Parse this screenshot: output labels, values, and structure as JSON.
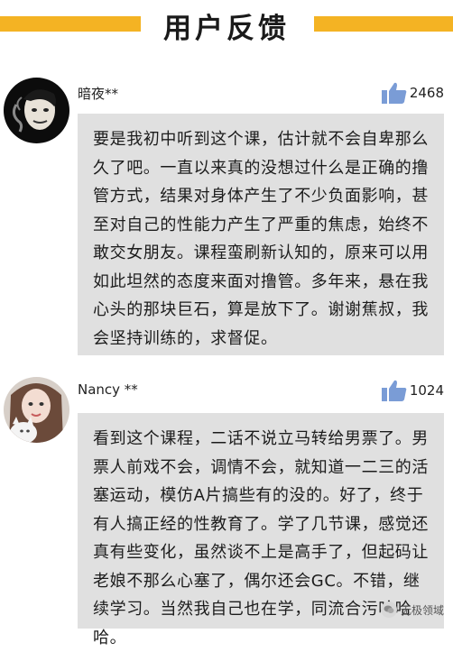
{
  "header": {
    "title": "用户反馈",
    "accent_color": "#f4b323"
  },
  "comments": [
    {
      "username": "暗夜**",
      "avatar": "avatar-smoking-man-icon",
      "likes": "2468",
      "text": "要是我初中听到这个课，估计就不会自卑那么久了吧。一直以来真的没想过什么是正确的撸管方式，结果对身体产生了不少负面影响，甚至对自己的性能力产生了严重的焦虑，始终不敢交女朋友。课程蛮刷新认知的，原来可以用如此坦然的态度来面对撸管。多年来，悬在我心头的那块巨石，算是放下了。谢谢蕉叔，我会坚持训练的，求督促。"
    },
    {
      "username": "Nancy **",
      "avatar": "avatar-girl-with-cat-icon",
      "likes": "1024",
      "text": "看到这个课程，二话不说立马转给男票了。男票人前戏不会，调情不会，就知道一二三的活塞运动，模仿A片搞些有的没的。好了，终于有人搞正经的性教育了。学了几节课，感觉还真有些变化，虽然谈不上是高手了，但起码让老娘不那么心塞了，偶尔还会GC。不错，继续学习。当然我自己也在学，同流合污哈哈哈。"
    }
  ],
  "watermark": {
    "text": "无极领域",
    "icon": "wechat-icon"
  },
  "colors": {
    "comment_bg": "#e0e0e0",
    "like_icon": "#7a9cd6"
  }
}
